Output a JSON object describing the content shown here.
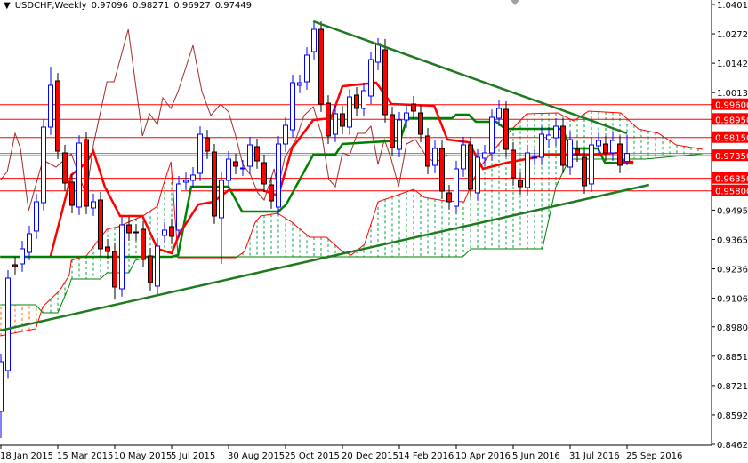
{
  "header": {
    "dropdown_icon": "triangle-down-icon",
    "symbol_timeframe": "USDCHF,Weekly",
    "open": "0.97096",
    "high": "0.98271",
    "low": "0.96927",
    "close": "0.97449"
  },
  "chart_data": {
    "type": "candlestick",
    "title": "USDCHF,Weekly",
    "price_axis": {
      "max": 1.04015,
      "min": 0.84625,
      "ticks": [
        "1.04015",
        "1.02720",
        "1.01425",
        "1.00130",
        "0.94950",
        "0.93655",
        "0.92360",
        "0.91065",
        "0.89805",
        "0.88510",
        "0.87215",
        "0.85920",
        "0.84625"
      ]
    },
    "x_labels": [
      {
        "bar": 0,
        "label": "18 Jan 2015"
      },
      {
        "bar": 8,
        "label": "15 Mar 2015"
      },
      {
        "bar": 16,
        "label": "10 May 2015"
      },
      {
        "bar": 24,
        "label": "5 Jul 2015"
      },
      {
        "bar": 32,
        "label": "30 Aug 2015"
      },
      {
        "bar": 40,
        "label": "25 Oct 2015"
      },
      {
        "bar": 48,
        "label": "20 Dec 2015"
      },
      {
        "bar": 56,
        "label": "14 Feb 2016"
      },
      {
        "bar": 64,
        "label": "10 Apr 2016"
      },
      {
        "bar": 72,
        "label": "5 Jun 2016"
      },
      {
        "bar": 80,
        "label": "31 Jul 2016"
      },
      {
        "bar": 88,
        "label": "25 Sep 2016"
      }
    ],
    "candles_oc": [
      [
        0.86075,
        0.88269
      ],
      [
        0.87877,
        0.91951
      ],
      [
        0.92539,
        0.9246
      ],
      [
        0.92578,
        0.93244
      ],
      [
        0.93087,
        0.93909
      ],
      [
        0.94027,
        0.95319
      ],
      [
        0.9528,
        0.9861
      ],
      [
        0.9861,
        1.00451
      ],
      [
        1.00646,
        0.97552
      ],
      [
        0.97474,
        0.96142
      ],
      [
        0.96181,
        0.95162
      ],
      [
        0.95084,
        0.97904
      ],
      [
        0.98061,
        0.95123
      ],
      [
        0.95045,
        0.95319
      ],
      [
        0.95398,
        0.93244
      ],
      [
        0.93322,
        0.93126
      ],
      [
        0.93126,
        0.91559
      ],
      [
        0.91481,
        0.94301
      ],
      [
        0.94301,
        0.93948
      ],
      [
        0.93988,
        0.93948
      ],
      [
        0.94105,
        0.92774
      ],
      [
        0.9293,
        0.91755
      ],
      [
        0.91598,
        0.93361
      ],
      [
        0.93831,
        0.94066
      ],
      [
        0.94223,
        0.93792
      ],
      [
        0.94066,
        0.96103
      ],
      [
        0.96181,
        0.96259
      ],
      [
        0.96259,
        0.96495
      ],
      [
        0.96573,
        0.98296
      ],
      [
        0.98139,
        0.97552
      ],
      [
        0.97513,
        0.94693
      ],
      [
        0.94615,
        0.96259
      ],
      [
        0.96259,
        0.972
      ],
      [
        0.97082,
        0.96886
      ],
      [
        0.96808,
        0.96808
      ],
      [
        0.96886,
        0.97826
      ],
      [
        0.97748,
        0.97121
      ],
      [
        0.97043,
        0.96103
      ],
      [
        0.96063,
        0.95358
      ],
      [
        0.95084,
        0.97865
      ],
      [
        0.97865,
        0.98688
      ],
      [
        0.98492,
        1.00568
      ],
      [
        1.00451,
        1.00568
      ],
      [
        1.00607,
        1.01782
      ],
      [
        1.01939,
        1.02918
      ],
      [
        1.02918,
        0.99628
      ],
      [
        0.99667,
        0.98218
      ],
      [
        0.98296,
        0.99197
      ],
      [
        0.99197,
        0.98649
      ],
      [
        0.9861,
        0.99941
      ],
      [
        1.0002,
        0.99432
      ],
      [
        0.99432,
        1.00216
      ],
      [
        0.9998,
        1.01586
      ],
      [
        1.01469,
        1.02292
      ],
      [
        1.02017,
        0.99158
      ],
      [
        0.99158,
        0.97709
      ],
      [
        0.9763,
        0.98923
      ],
      [
        0.98923,
        0.99236
      ],
      [
        0.99628,
        0.99315
      ],
      [
        0.99236,
        0.98296
      ],
      [
        0.98218,
        0.96886
      ],
      [
        0.96925,
        0.97669
      ],
      [
        0.97669,
        0.95789
      ],
      [
        0.95711,
        0.95319
      ],
      [
        0.95123,
        0.96769
      ],
      [
        0.96769,
        0.97826
      ],
      [
        0.97826,
        0.95868
      ],
      [
        0.95711,
        0.97278
      ],
      [
        0.97239,
        0.97474
      ],
      [
        0.97474,
        0.9904
      ],
      [
        0.99001,
        0.99432
      ],
      [
        0.99393,
        0.9763
      ],
      [
        0.97591,
        0.96377
      ],
      [
        0.96259,
        0.95985
      ],
      [
        0.95946,
        0.97474
      ],
      [
        0.97278,
        0.97278
      ],
      [
        0.97278,
        0.98296
      ],
      [
        0.98061,
        0.98257
      ],
      [
        0.98139,
        0.98649
      ],
      [
        0.98649,
        0.96925
      ],
      [
        0.96847,
        0.98061
      ],
      [
        0.9763,
        0.97434
      ],
      [
        0.97278,
        0.96024
      ],
      [
        0.96103,
        0.97826
      ],
      [
        0.97787,
        0.98022
      ],
      [
        0.97865,
        0.97474
      ],
      [
        0.97474,
        0.98022
      ],
      [
        0.97865,
        0.96925
      ],
      [
        0.97096,
        0.97449
      ]
    ],
    "known_extremes": {
      "0": {
        "l": 0.849
      },
      "1": {
        "l": 0.8755
      },
      "7": {
        "h": 1.0127
      },
      "16": {
        "l": 0.91
      },
      "31": {
        "l": 0.9258
      },
      "44": {
        "h": 1.0327
      },
      "53": {
        "h": 1.0253
      },
      "54": {
        "h": 1.0249
      },
      "88": {
        "h": 0.98271,
        "l": 0.96927
      }
    },
    "levels": [
      {
        "price": 0.996,
        "label": "0.99600"
      },
      {
        "price": 0.9895,
        "label": "0.98950"
      },
      {
        "price": 0.9815,
        "label": "0.98150"
      },
      {
        "price": 0.9735,
        "label": "0.97350"
      },
      {
        "price": 0.9635,
        "label": "0.96350"
      },
      {
        "price": 0.958,
        "label": "0.95800"
      }
    ],
    "current_price": 0.97449,
    "trendlines": [
      {
        "name": "resistance",
        "points": [
          [
            43.9,
            1.03271
          ],
          [
            88.0,
            0.98335
          ]
        ]
      },
      {
        "name": "support",
        "points": [
          [
            -0.1,
            0.8964
          ],
          [
            91.1,
            0.96063
          ]
        ]
      }
    ],
    "ichimoku": {
      "tenkan": [
        [
          7,
          0.9293
        ],
        [
          9.9,
          0.96495
        ],
        [
          12,
          0.97043
        ],
        [
          13,
          0.97552
        ],
        [
          14.6,
          0.95985
        ],
        [
          16.75,
          0.94693
        ],
        [
          19.9,
          0.94693
        ],
        [
          22,
          0.93244
        ],
        [
          24,
          0.93047
        ],
        [
          25.1,
          0.93909
        ],
        [
          27.75,
          0.95201
        ],
        [
          29.9,
          0.95319
        ],
        [
          32,
          0.95828
        ],
        [
          36.75,
          0.95828
        ],
        [
          39,
          0.95593
        ],
        [
          40.9,
          0.97669
        ],
        [
          43.9,
          0.98923
        ],
        [
          46.4,
          0.99001
        ],
        [
          48,
          1.00411
        ],
        [
          52.75,
          1.00568
        ],
        [
          54.9,
          0.99628
        ],
        [
          60.9,
          0.9955
        ],
        [
          62.75,
          0.98061
        ],
        [
          65.75,
          0.97943
        ],
        [
          67.75,
          0.96769
        ],
        [
          71.1,
          0.97043
        ],
        [
          75.1,
          0.97278
        ],
        [
          76.1,
          0.97395
        ],
        [
          82.6,
          0.97395
        ],
        [
          86.75,
          0.97474
        ],
        [
          87.6,
          0.97082
        ],
        [
          88.9,
          0.97082
        ]
      ],
      "kijun": [
        [
          -0.1,
          0.9289
        ],
        [
          24,
          0.9289
        ],
        [
          24.9,
          0.92969
        ],
        [
          26.75,
          0.95985
        ],
        [
          32,
          0.95985
        ],
        [
          33.9,
          0.94888
        ],
        [
          39,
          0.94888
        ],
        [
          40.1,
          0.95201
        ],
        [
          43.9,
          0.97395
        ],
        [
          47,
          0.97395
        ],
        [
          48,
          0.97865
        ],
        [
          56.1,
          0.98022
        ],
        [
          57.1,
          0.99001
        ],
        [
          63.4,
          0.99001
        ],
        [
          64,
          0.99158
        ],
        [
          65.75,
          0.99158
        ],
        [
          66.75,
          0.98845
        ],
        [
          69.6,
          0.98845
        ],
        [
          70.9,
          0.98531
        ],
        [
          78.9,
          0.98531
        ],
        [
          80.1,
          0.97669
        ],
        [
          83.9,
          0.97669
        ],
        [
          84.9,
          0.97043
        ],
        [
          88.9,
          0.97004
        ]
      ],
      "chikou": [
        [
          -0.1,
          0.96259
        ],
        [
          0.9,
          0.96651
        ],
        [
          2,
          0.98335
        ],
        [
          2.75,
          0.97669
        ],
        [
          3.9,
          0.94928
        ],
        [
          5.9,
          0.9716
        ],
        [
          7.75,
          0.96847
        ],
        [
          9.9,
          0.97434
        ],
        [
          12,
          0.95593
        ],
        [
          13,
          0.97826
        ],
        [
          14.9,
          1.00607
        ],
        [
          15.9,
          1.00607
        ],
        [
          17.9,
          1.02918
        ],
        [
          19.9,
          0.98218
        ],
        [
          20.9,
          0.99197
        ],
        [
          22,
          0.98727
        ],
        [
          22.75,
          0.99902
        ],
        [
          23.9,
          0.99432
        ],
        [
          24.9,
          1.00177
        ],
        [
          27,
          1.02213
        ],
        [
          28.25,
          1.00177
        ],
        [
          29.5,
          0.99119
        ],
        [
          30.9,
          0.99628
        ],
        [
          32,
          0.99276
        ],
        [
          33,
          0.98218
        ],
        [
          34,
          0.96964
        ],
        [
          35.1,
          0.96495
        ],
        [
          36.1,
          0.95711
        ],
        [
          37,
          0.95397
        ],
        [
          38.4,
          0.96769
        ],
        [
          38.9,
          0.95868
        ],
        [
          39.9,
          0.97278
        ],
        [
          41.4,
          0.98022
        ],
        [
          42.6,
          0.99119
        ],
        [
          43.9,
          0.99511
        ],
        [
          45.1,
          0.98257
        ],
        [
          46.1,
          0.96299
        ],
        [
          47,
          0.95985
        ],
        [
          48,
          0.97474
        ],
        [
          49,
          0.97356
        ],
        [
          50.1,
          0.98335
        ],
        [
          51.1,
          0.98335
        ],
        [
          52,
          0.98649
        ],
        [
          53,
          0.96964
        ],
        [
          53.9,
          0.98061
        ],
        [
          54.9,
          0.9716
        ],
        [
          55.9,
          0.95985
        ],
        [
          57,
          0.97865
        ],
        [
          58.25,
          0.98061
        ],
        [
          59.9,
          0.97278
        ],
        [
          61.1,
          0.97043
        ],
        [
          62.75,
          0.97395
        ]
      ],
      "senkou_a": [
        [
          -0.1,
          0.89405
        ],
        [
          4.9,
          0.89718
        ],
        [
          5.9,
          0.90697
        ],
        [
          8.25,
          0.91402
        ],
        [
          9.6,
          0.92068
        ],
        [
          9.9,
          0.92734
        ],
        [
          12,
          0.9293
        ],
        [
          14.9,
          0.94105
        ],
        [
          16.5,
          0.94223
        ],
        [
          19.9,
          0.94693
        ],
        [
          22,
          0.95123
        ],
        [
          22.75,
          0.95985
        ],
        [
          23.9,
          0.97082
        ],
        [
          24.9,
          0.92852
        ],
        [
          33,
          0.92852
        ],
        [
          34.25,
          0.93126
        ],
        [
          35.75,
          0.94418
        ],
        [
          36.5,
          0.94693
        ],
        [
          38.9,
          0.9481
        ],
        [
          40.9,
          0.94418
        ],
        [
          43.4,
          0.93752
        ],
        [
          45.75,
          0.93752
        ],
        [
          48,
          0.93126
        ],
        [
          49.25,
          0.92969
        ],
        [
          51.1,
          0.93439
        ],
        [
          53,
          0.95319
        ],
        [
          55.9,
          0.95633
        ],
        [
          58,
          0.95868
        ],
        [
          59.5,
          0.95515
        ],
        [
          62.4,
          0.95358
        ],
        [
          65.1,
          0.95319
        ],
        [
          67.1,
          0.96769
        ],
        [
          70.9,
          0.98218
        ],
        [
          73.9,
          0.99197
        ],
        [
          78.25,
          0.99236
        ],
        [
          80.5,
          0.98884
        ],
        [
          82.6,
          0.99315
        ],
        [
          87.1,
          0.99236
        ],
        [
          89.6,
          0.98527
        ],
        [
          92.4,
          0.98335
        ],
        [
          94.9,
          0.97826
        ],
        [
          98.6,
          0.9763
        ]
      ],
      "senkou_b": [
        [
          -0.1,
          0.90776
        ],
        [
          4.9,
          0.90776
        ],
        [
          5.9,
          0.90423
        ],
        [
          8,
          0.90423
        ],
        [
          9.6,
          0.91598
        ],
        [
          9.9,
          0.91911
        ],
        [
          14,
          0.91911
        ],
        [
          14.9,
          0.92186
        ],
        [
          18,
          0.92186
        ],
        [
          18.9,
          0.92734
        ],
        [
          20.75,
          0.92891
        ],
        [
          64.9,
          0.92891
        ],
        [
          66.1,
          0.93244
        ],
        [
          76.1,
          0.93244
        ],
        [
          78,
          0.95985
        ],
        [
          79.9,
          0.97199
        ],
        [
          90.5,
          0.97199
        ],
        [
          98.6,
          0.97434
        ]
      ]
    },
    "colors": {
      "bull": "#0000ff",
      "bear": "#ff0000",
      "tenkan": "#ff0000",
      "kijun": "#008000",
      "chikou": "#a52a2a",
      "cloud_bull": "#00a040",
      "cloud_bear": "#ff6000",
      "level": "#ff0000",
      "trendline": "#1e7a1e",
      "current_price": "#808080"
    }
  }
}
